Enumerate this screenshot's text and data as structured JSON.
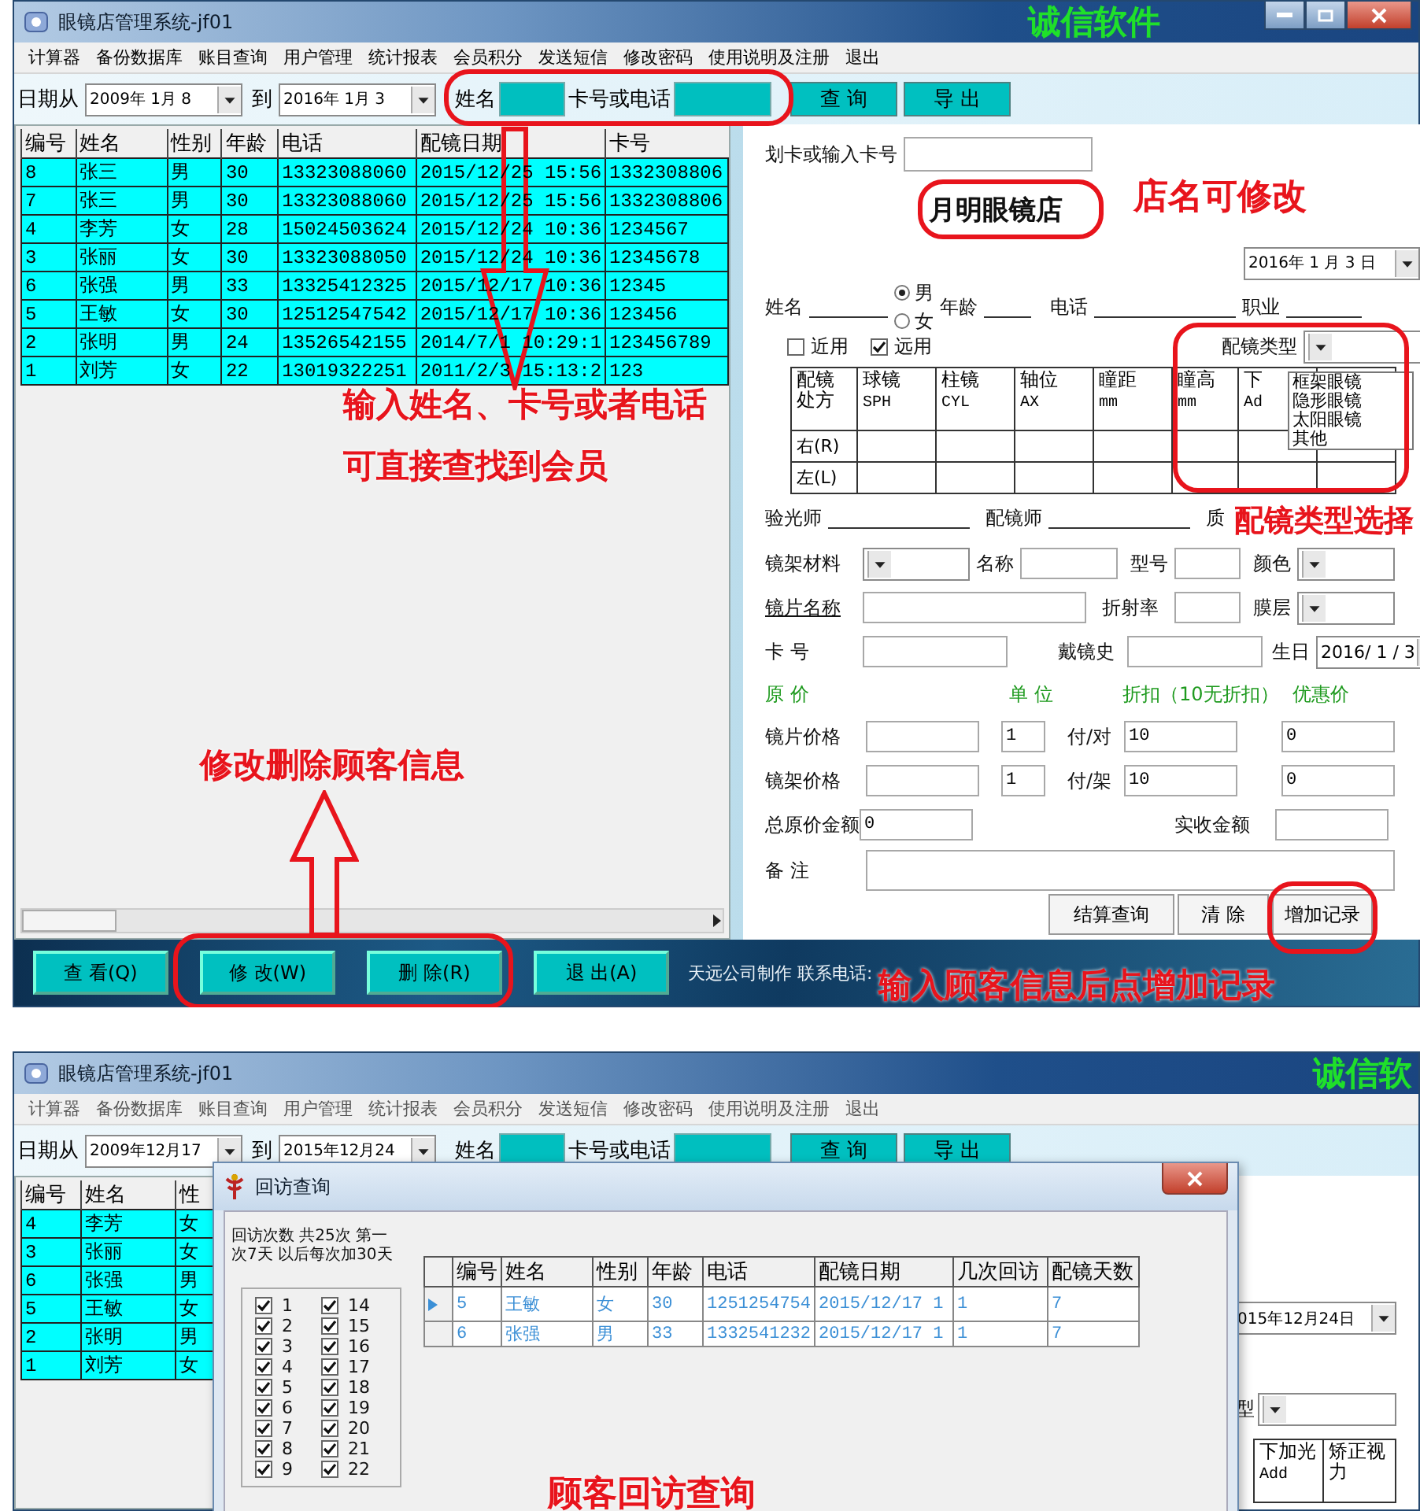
{
  "main": {
    "window": {
      "title": "眼镜店管理系统-jf01",
      "brand": "诚信软件"
    },
    "menu": [
      "计算器",
      "备份数据库",
      "账目查询",
      "用户管理",
      "统计报表",
      "会员积分",
      "发送短信",
      "修改密码",
      "使用说明及注册",
      "退出"
    ],
    "filter": {
      "date_from_label": "日期从",
      "date_from": "2009年 1月 8",
      "to_label": "到",
      "date_to": "2016年 1月 3",
      "name_label": "姓名",
      "card_label": "卡号或电话",
      "buttons": [
        "查 询",
        "导 出"
      ]
    },
    "table": {
      "columns": [
        "编号",
        "姓名",
        "性别",
        "年龄",
        "电话",
        "配镜日期",
        "卡号"
      ],
      "rows": [
        [
          "8",
          "张三",
          "男",
          "30",
          "13323088060",
          "2015/12/25 15:56",
          "1332308806"
        ],
        [
          "7",
          "张三",
          "男",
          "30",
          "13323088060",
          "2015/12/25 15:56",
          "1332308806"
        ],
        [
          "4",
          "李芳",
          "女",
          "28",
          "15024503624",
          "2015/12/24 10:36",
          "1234567"
        ],
        [
          "3",
          "张丽",
          "女",
          "30",
          "13323088050",
          "2015/12/24 10:36",
          "12345678"
        ],
        [
          "6",
          "张强",
          "男",
          "33",
          "13325412325",
          "2015/12/17 10:36",
          "12345"
        ],
        [
          "5",
          "王敏",
          "女",
          "30",
          "12512547542",
          "2015/12/17 10:36",
          "123456"
        ],
        [
          "2",
          "张明",
          "男",
          "24",
          "13526542155",
          "2014/7/1 10:29:1",
          "123456789"
        ],
        [
          "1",
          "刘芳",
          "女",
          "22",
          "13019322251",
          "2011/2/3 15:13:2",
          "123"
        ]
      ]
    },
    "form": {
      "card_label": "划卡或输入卡号",
      "shop_name": "月明眼镜店",
      "date": "2016年 1 月 3 日",
      "name_label": "姓名",
      "gender": [
        {
          "label": "男",
          "selected": true
        },
        {
          "label": "女",
          "selected": false
        }
      ],
      "age_label": "年龄",
      "phone_label": "电话",
      "job_label": "职业",
      "use": [
        {
          "label": "近用",
          "checked": false
        },
        {
          "label": "远用",
          "checked": true
        }
      ],
      "type_label": "配镜类型",
      "type_options": [
        "框架眼镜",
        "隐形眼镜",
        "太阳眼镜",
        "其他"
      ],
      "rx": {
        "columns": [
          {
            "title": "配镜处方"
          },
          {
            "title": "球镜",
            "unit": "SPH"
          },
          {
            "title": "柱镜",
            "unit": "CYL"
          },
          {
            "title": "轴位",
            "unit": "AX"
          },
          {
            "title": "瞳距",
            "unit": "mm"
          },
          {
            "title": "瞳高",
            "unit": "mm"
          },
          {
            "title": "下",
            "unit": "Ad"
          },
          {}
        ],
        "rows": [
          "右(R)",
          "左(L)"
        ]
      },
      "staff": [
        "验光师",
        "配镜师",
        "质"
      ],
      "frame_row": {
        "material": "镜架材料",
        "name": "名称",
        "model": "型号",
        "shade_label": "颜色"
      },
      "lens_row": {
        "name": "镜片名称",
        "index": "折射率",
        "coating": "膜层"
      },
      "card_row": {
        "card": "卡 号",
        "history": "戴镜史",
        "birthday": "生日",
        "birthday_value": "2016/ 1 / 3"
      },
      "price_headers": [
        "原 价",
        "单 位",
        "折扣（10无折扣）",
        "优惠价"
      ],
      "prices": [
        {
          "label": "镜片价格",
          "qty": "1",
          "unit": "付/对",
          "discount": "10",
          "final": "0"
        },
        {
          "label": "镜架价格",
          "qty": "1",
          "unit": "付/架",
          "discount": "10",
          "final": "0"
        }
      ],
      "total_label": "总原价金额",
      "total": "0",
      "paid_label": "实收金额",
      "note_label": "备 注",
      "buttons": [
        "结算查询",
        "清 除",
        "增加记录"
      ]
    },
    "actions": [
      "查 看(Q)",
      "修 改(W)",
      "删 除(R)",
      "退 出(A)"
    ],
    "footer": "天远公司制作 联系电话:",
    "annotations": [
      "店名可修改",
      "输入姓名、卡号或者电话",
      "可直接查找到会员",
      "配镜类型选择",
      "修改删除顾客信息",
      "输入顾客信息后点增加记录"
    ]
  },
  "visit": {
    "window": {
      "title": "眼镜店管理系统-jf01",
      "brand": "诚信软"
    },
    "menu": [
      "计算器",
      "备份数据库",
      "账目查询",
      "用户管理",
      "统计报表",
      "会员积分",
      "发送短信",
      "修改密码",
      "使用说明及注册",
      "退出"
    ],
    "filter": {
      "date_from_label": "日期从",
      "date_from": "2009年12月17",
      "to_label": "到",
      "date_to": "2015年12月24",
      "name_label": "姓名",
      "card_label": "卡号或电话",
      "buttons": [
        "查 询",
        "导 出"
      ]
    },
    "table": {
      "columns": [
        "编号",
        "姓名",
        "性"
      ],
      "rows": [
        [
          "4",
          "李芳",
          "女"
        ],
        [
          "3",
          "张丽",
          "女"
        ],
        [
          "6",
          "张强",
          "男"
        ],
        [
          "5",
          "王敏",
          "女"
        ],
        [
          "2",
          "张明",
          "男"
        ],
        [
          "1",
          "刘芳",
          "女"
        ]
      ]
    },
    "background_form": {
      "date": "015年12月24日",
      "type_label": "型",
      "rx_columns": [
        {
          "title": "下加光",
          "unit": "Add"
        },
        {
          "title": "矫正视力"
        }
      ]
    },
    "dialog": {
      "title": "回访查询",
      "note": "回访次数 共25次 第一次7天 以后每次加30天",
      "visits": [
        {
          "label": "1",
          "checked": true
        },
        {
          "label": "2",
          "checked": true
        },
        {
          "label": "3",
          "checked": true
        },
        {
          "label": "4",
          "checked": true
        },
        {
          "label": "5",
          "checked": true
        },
        {
          "label": "6",
          "checked": true
        },
        {
          "label": "7",
          "checked": true
        },
        {
          "label": "8",
          "checked": true
        },
        {
          "label": "9",
          "checked": true
        },
        {
          "label": "14",
          "checked": true
        },
        {
          "label": "15",
          "checked": true
        },
        {
          "label": "16",
          "checked": true
        },
        {
          "label": "17",
          "checked": true
        },
        {
          "label": "18",
          "checked": true
        },
        {
          "label": "19",
          "checked": true
        },
        {
          "label": "20",
          "checked": true
        },
        {
          "label": "21",
          "checked": true
        },
        {
          "label": "22",
          "checked": true
        }
      ],
      "table": {
        "columns": [
          "编号",
          "姓名",
          "性别",
          "年龄",
          "电话",
          "配镜日期",
          "几次回访",
          "配镜天数"
        ],
        "rows": [
          {
            "selected": true,
            "cells": [
              "5",
              "王敏",
              "女",
              "30",
              "1251254754",
              "2015/12/17 1",
              "1",
              "7"
            ]
          },
          {
            "selected": false,
            "cells": [
              "6",
              "张强",
              "男",
              "33",
              "1332541232",
              "2015/12/17 1",
              "1",
              "7"
            ]
          }
        ]
      }
    },
    "annotation": "顾客回访查询"
  }
}
